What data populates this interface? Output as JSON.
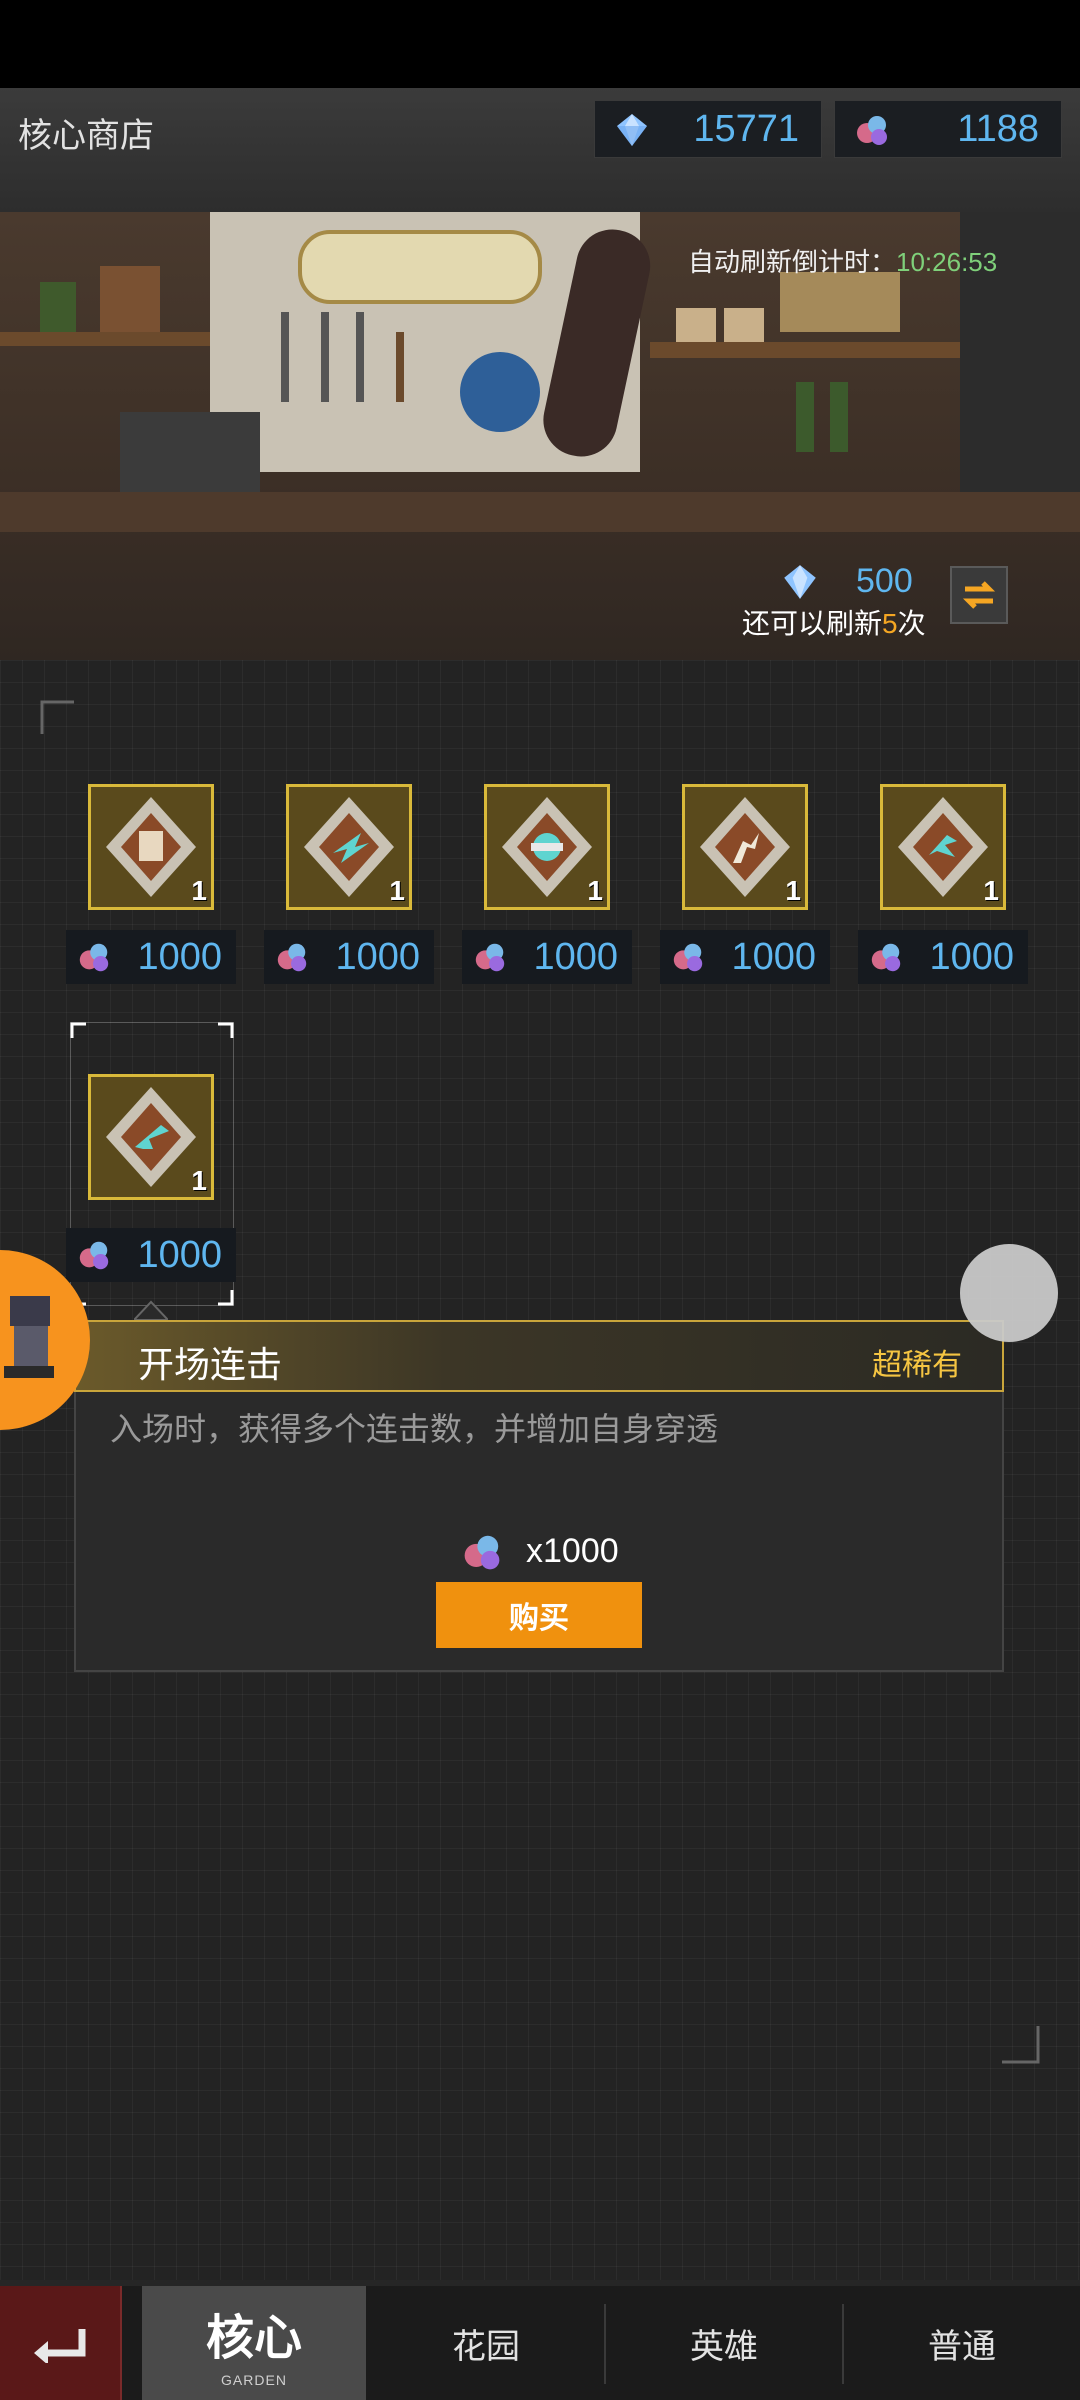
{
  "header": {
    "title": "核心商店",
    "currencies": [
      {
        "icon": "crystal-gem-icon",
        "value": "15771"
      },
      {
        "icon": "hero-core-icon",
        "value": "1188"
      }
    ]
  },
  "refresh": {
    "label": "自动刷新倒计时：",
    "time": "10:26:53",
    "cost": "500",
    "remaining_prefix": "还可以刷新",
    "remaining_count": "5",
    "remaining_suffix": "次"
  },
  "items": [
    {
      "icon": "figures-core-icon",
      "qty": "1",
      "price": "1000"
    },
    {
      "icon": "dash-core-icon",
      "qty": "1",
      "price": "1000"
    },
    {
      "icon": "burst-core-icon",
      "qty": "1",
      "price": "1000"
    },
    {
      "icon": "runner-core-icon",
      "qty": "1",
      "price": "1000"
    },
    {
      "icon": "strike-core-icon",
      "qty": "1",
      "price": "1000"
    },
    {
      "icon": "gun-core-icon",
      "qty": "1",
      "price": "1000"
    }
  ],
  "detail": {
    "name": "开场连击",
    "rarity": "超稀有",
    "description": "入场时，获得多个连击数，并增加自身穿透",
    "cost": "x1000",
    "buy_label": "购买"
  },
  "nav": {
    "tabs": [
      {
        "label": "核心",
        "sub": "GARDEN"
      },
      {
        "label": "花园"
      },
      {
        "label": "英雄"
      },
      {
        "label": "普通"
      }
    ]
  },
  "colors": {
    "accent_blue": "#5fb6ef",
    "gold": "#d9b93a",
    "buy_orange": "#f0910e",
    "timer_green": "#7fd07a"
  }
}
